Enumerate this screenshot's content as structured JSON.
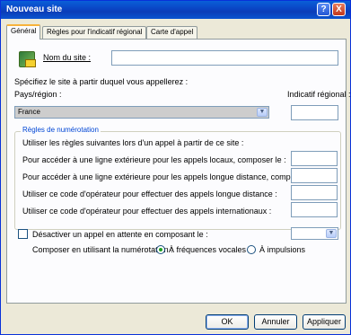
{
  "window": {
    "title": "Nouveau site"
  },
  "titlebar": {
    "help": "?",
    "close": "X"
  },
  "tabs": [
    {
      "label": "Général"
    },
    {
      "label": "Règles pour l'indicatif régional"
    },
    {
      "label": "Carte d'appel"
    }
  ],
  "site": {
    "name_label": "Nom du site :",
    "name_value": ""
  },
  "location": {
    "instruction": "Spécifiez le site à partir duquel vous appellerez :",
    "country_label": "Pays/région :",
    "country_value": "France",
    "area_code_label": "Indicatif régional :",
    "area_code_value": ""
  },
  "dialing": {
    "group_title": "Règles de numérotation",
    "intro": "Utiliser les règles suivantes lors d'un appel à partir de ce site :",
    "local_label": "Pour accéder à une ligne extérieure pour les appels locaux, composer le :",
    "long_label": "Pour accéder à une ligne extérieure pour les appels longue distance, composer le :",
    "carrier_long_label": "Utiliser ce code d'opérateur pour effectuer des appels longue distance :",
    "carrier_intl_label": "Utiliser ce code d'opérateur pour effectuer des appels internationaux :"
  },
  "call_waiting": {
    "label": "Désactiver un appel en attente en composant le :"
  },
  "dial_using": {
    "label": "Composer en utilisant la numérotation :",
    "tone": "À fréquences vocales",
    "pulse": "À impulsions",
    "selected": "tone"
  },
  "buttons": {
    "ok": "OK",
    "cancel": "Annuler",
    "apply": "Appliquer"
  }
}
